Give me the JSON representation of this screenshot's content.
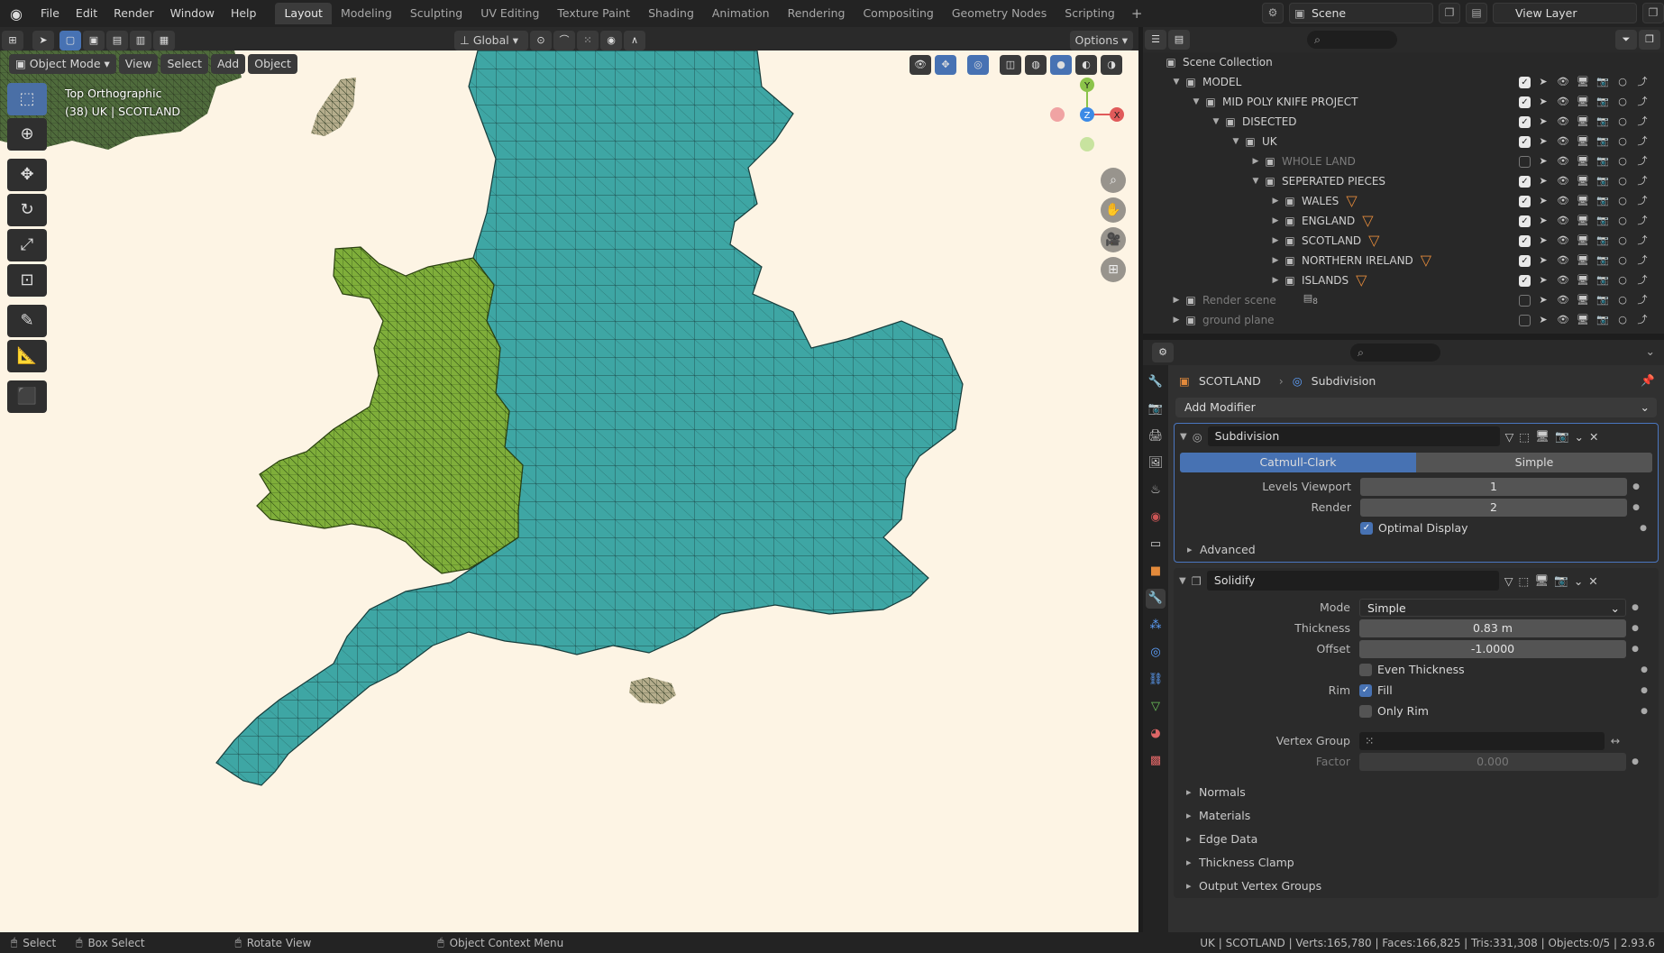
{
  "topbar": {
    "menus": [
      "File",
      "Edit",
      "Render",
      "Window",
      "Help"
    ],
    "workspaces": [
      "Layout",
      "Modeling",
      "Sculpting",
      "UV Editing",
      "Texture Paint",
      "Shading",
      "Animation",
      "Rendering",
      "Compositing",
      "Geometry Nodes",
      "Scripting"
    ],
    "active_workspace": "Layout",
    "scene": "Scene",
    "view_layer": "View Layer"
  },
  "viewport_header": {
    "transform_orientation": "Global",
    "options": "Options"
  },
  "viewport": {
    "mode": "Object Mode",
    "menus": [
      "View",
      "Select",
      "Add",
      "Object"
    ],
    "view_name": "Top Orthographic",
    "context": "(38) UK | SCOTLAND",
    "axes": {
      "x": "X",
      "y": "Y",
      "z": "Z"
    },
    "colors": {
      "background": "#fdf4e4",
      "wales": "#7fae3a",
      "england": "#3ea6a4",
      "other": "#b5ad8c"
    }
  },
  "outliner": {
    "root": "Scene Collection",
    "rows": [
      {
        "name": "MODEL",
        "depth": 0,
        "dim": false,
        "filter": false,
        "check": true
      },
      {
        "name": "MID POLY KNIFE PROJECT",
        "depth": 1,
        "dim": false,
        "filter": false,
        "check": true
      },
      {
        "name": "DISECTED",
        "depth": 2,
        "dim": false,
        "filter": false,
        "check": true
      },
      {
        "name": "UK",
        "depth": 3,
        "dim": false,
        "filter": false,
        "check": true
      },
      {
        "name": "WHOLE LAND",
        "depth": 4,
        "dim": true,
        "filter": false,
        "check": false
      },
      {
        "name": "SEPERATED PIECES",
        "depth": 4,
        "dim": false,
        "filter": false,
        "check": true
      },
      {
        "name": "WALES",
        "depth": 5,
        "dim": false,
        "filter": true,
        "check": true
      },
      {
        "name": "ENGLAND",
        "depth": 5,
        "dim": false,
        "filter": true,
        "check": true
      },
      {
        "name": "SCOTLAND",
        "depth": 5,
        "dim": false,
        "filter": true,
        "check": true
      },
      {
        "name": "NORTHERN IRELAND",
        "depth": 5,
        "dim": false,
        "filter": true,
        "check": true
      },
      {
        "name": "ISLANDS",
        "depth": 5,
        "dim": false,
        "filter": true,
        "check": true
      },
      {
        "name": "Render scene",
        "depth": 0,
        "dim": true,
        "filter": false,
        "check": false,
        "badge": "8"
      },
      {
        "name": "ground plane",
        "depth": 0,
        "dim": true,
        "filter": false,
        "check": false
      }
    ]
  },
  "properties": {
    "object": "SCOTLAND",
    "modifier_context": "Subdivision",
    "add_modifier": "Add Modifier",
    "subdivision": {
      "name": "Subdivision",
      "method_a": "Catmull-Clark",
      "method_b": "Simple",
      "levels_viewport_label": "Levels Viewport",
      "levels_viewport": "1",
      "render_label": "Render",
      "render": "2",
      "optimal_display": "Optimal Display",
      "advanced": "Advanced"
    },
    "solidify": {
      "name": "Solidify",
      "mode_label": "Mode",
      "mode": "Simple",
      "thickness_label": "Thickness",
      "thickness": "0.83 m",
      "offset_label": "Offset",
      "offset": "-1.0000",
      "even_thickness": "Even Thickness",
      "rim_label": "Rim",
      "fill": "Fill",
      "only_rim": "Only Rim",
      "vertex_group_label": "Vertex Group",
      "factor_label": "Factor",
      "factor": "0.000",
      "sections": [
        "Normals",
        "Materials",
        "Edge Data",
        "Thickness Clamp",
        "Output Vertex Groups"
      ]
    }
  },
  "statusbar": {
    "select": "Select",
    "box_select": "Box Select",
    "rotate": "Rotate View",
    "context_menu": "Object Context Menu",
    "stats": "UK | SCOTLAND | Verts:165,780 | Faces:166,825 | Tris:331,308 | Objects:0/5 | 2.93.6"
  }
}
